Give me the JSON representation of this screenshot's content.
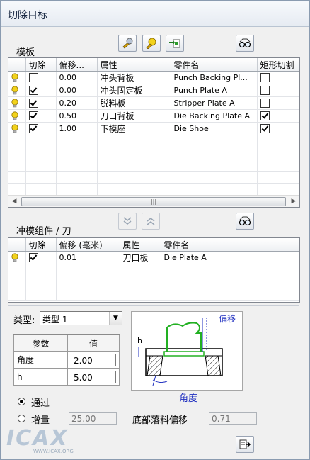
{
  "title": "切除目标",
  "template_section": {
    "label": "模板",
    "columns": [
      "",
      "切除",
      "偏移...",
      "属性",
      "零件名",
      "矩形切割"
    ],
    "rows": [
      {
        "cut": false,
        "offset": "0.00",
        "attribute": "冲头背板",
        "part": "Punch Backing Pl...",
        "rect": false
      },
      {
        "cut": true,
        "offset": "0.00",
        "attribute": "冲头固定板",
        "part": "Punch Plate A",
        "rect": false
      },
      {
        "cut": true,
        "offset": "0.20",
        "attribute": "脱料板",
        "part": "Stripper Plate A",
        "rect": false
      },
      {
        "cut": true,
        "offset": "0.50",
        "attribute": "刀口背板",
        "part": "Die Backing Plate A",
        "rect": true
      },
      {
        "cut": true,
        "offset": "1.00",
        "attribute": "下模座",
        "part": "Die Shoe",
        "rect": true
      }
    ],
    "empty_rows": 6
  },
  "die_section": {
    "label": "冲模组件 / 刀",
    "columns": [
      "",
      "切除",
      "偏移 (毫米)",
      "属性",
      "零件名"
    ],
    "rows": [
      {
        "cut": true,
        "offset": "0.01",
        "attribute": "刀口板",
        "part": "Die Plate A"
      }
    ],
    "empty_rows": 3
  },
  "type_select": {
    "label": "类型:",
    "value": "类型 1"
  },
  "params": {
    "header_param": "参数",
    "header_value": "值",
    "rows": [
      {
        "name": "角度",
        "value": "2.00"
      },
      {
        "name": "h",
        "value": "5.00"
      }
    ]
  },
  "diagram": {
    "offset_label": "偏移",
    "angle_label": "角度",
    "h_label": "h"
  },
  "mode": {
    "through_label": "通过",
    "through_selected": true,
    "increment_label": "增量",
    "increment_value": "25.00",
    "bottom_offset_label": "底部落料偏移",
    "bottom_offset_value": "0.71"
  },
  "watermark": "ICAX",
  "watermark_sub": "WWW.ICAX.ORG",
  "colors": {
    "bulb": "#f2d21b",
    "part_outline": "#22b022",
    "dim_blue": "#2030c0"
  }
}
